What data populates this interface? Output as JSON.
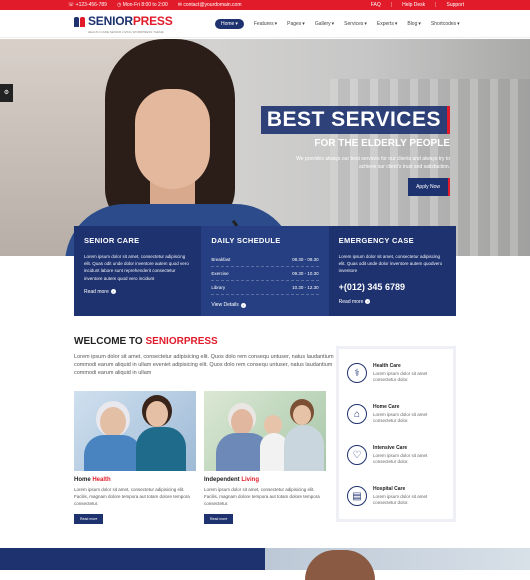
{
  "topbar": {
    "phone": "+123-456-789",
    "hours": "Mon-Fri 8:00 to 2:00",
    "email": "contact@yourdomain.com",
    "links": [
      "FAQ",
      "Help Desk",
      "Support"
    ]
  },
  "brand": {
    "name_a": "SENIOR",
    "name_b": "PRESS",
    "tagline": "HEALTH CARE SENIOR LIVING WORDPRESS THEME"
  },
  "nav": [
    {
      "label": "Home",
      "active": true
    },
    {
      "label": "Features",
      "active": false
    },
    {
      "label": "Pages",
      "active": false
    },
    {
      "label": "Gallery",
      "active": false
    },
    {
      "label": "Services",
      "active": false
    },
    {
      "label": "Experts",
      "active": false
    },
    {
      "label": "Blog",
      "active": false
    },
    {
      "label": "Shortcodes",
      "active": false
    }
  ],
  "hero": {
    "title": "BEST SERVICES",
    "subtitle": "FOR THE ELDERLY PEOPLE",
    "desc": "We provides always our best services for our clients and always try to achieve our client's trust and satisfaction.",
    "button": "Apply Now"
  },
  "info": {
    "senior_care": {
      "title": "SENIOR CARE",
      "text": "Lorem ipsum dolor sit amet, consectetur adipiscing elit. Quas odit unde dolor inventore autem quod vero incidunt labore sunt reprehenderit consectetur inventore autem quod vero incidunt",
      "link": "Read more"
    },
    "schedule": {
      "title": "DAILY SCHEDULE",
      "rows": [
        {
          "label": "Breakfast",
          "time": "08.30 - 09.30"
        },
        {
          "label": "Exercise",
          "time": "09.30 - 10.30"
        },
        {
          "label": "Library",
          "time": "10.30 - 12.30"
        }
      ],
      "link": "View Details"
    },
    "emergency": {
      "title": "EMERGENCY CASE",
      "text": "Lorem ipsum dolor sit amet, consectetur adipiscing elit. Quas odit unde dolor inventore autem quodvero inventore",
      "phone": "+(012) 345 6789",
      "link": "Read more"
    }
  },
  "welcome": {
    "title_a": "WELCOME TO ",
    "title_b": "SENIORPRESS",
    "lead": "Lorem ipsum dolor sit amet, consectetur adipisicing elit. Quos dolo rem consequ untuser, natus laudantium commodi earum aliquid in ullam eveniet adipisicing elit. Quos dolo rem consequ untuser, natus laudantium commodi earum aliquid in ullam"
  },
  "cards": [
    {
      "title_a": "Home ",
      "title_b": "Health",
      "desc": "Lorem ipsum dolor sit amet, consectetur adipisicing elit. Facilis, magnam dolore tempora aut totam dolore tempora consectetur.",
      "button": "Read more"
    },
    {
      "title_a": "Independent ",
      "title_b": "Living",
      "desc": "Lorem ipsum dolor sit amet, consectetur adipisicing elit. Facilis, magnam dolore tempora aut totam dolore tempora consectetur.",
      "button": "Read more"
    }
  ],
  "services": [
    {
      "title": "Health Care",
      "desc": "Lorem ipsum dolor sit amet consectetur dolor.",
      "icon": "stethoscope-icon"
    },
    {
      "title": "Home Care",
      "desc": "Lorem ipsum dolor sit amet consectetur dolor.",
      "icon": "house-icon"
    },
    {
      "title": "Intensive Care",
      "desc": "Lorem ipsum dolor sit amet consectetur dolor.",
      "icon": "heartbeat-icon"
    },
    {
      "title": "Hospital Care",
      "desc": "Lorem ipsum dolor sit amet consectetur dolor.",
      "icon": "clipboard-icon"
    }
  ],
  "colors": {
    "brand_blue": "#1e3270",
    "brand_red": "#e11b2a"
  }
}
